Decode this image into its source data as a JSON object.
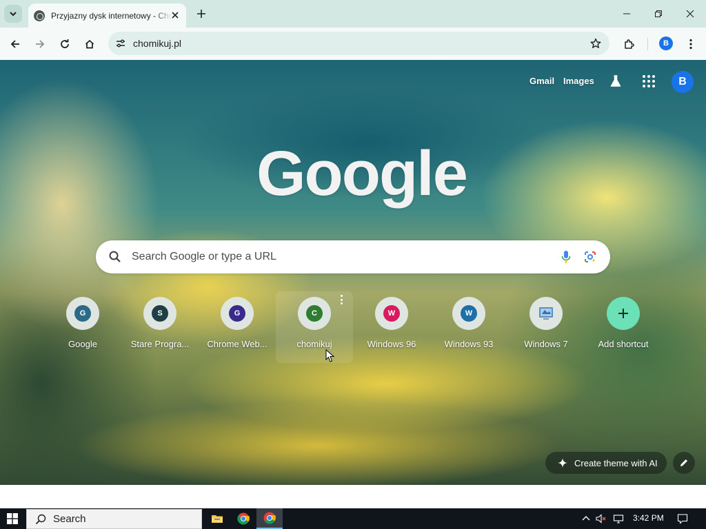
{
  "browser": {
    "tab": {
      "title": "Przyjazny dysk internetowy - Chomikuj.pl"
    },
    "omnibox": {
      "url": "chomikuj.pl"
    },
    "profile_initial": "B"
  },
  "ntp": {
    "top_links": {
      "gmail": "Gmail",
      "images": "Images"
    },
    "profile_initial": "B",
    "logo_text": "Google",
    "search": {
      "placeholder": "Search Google or type a URL"
    },
    "shortcuts": [
      {
        "label": "Google",
        "initial": "G",
        "color": "#2c6b87"
      },
      {
        "label": "Stare Progra...",
        "initial": "S",
        "color": "#1f3f46"
      },
      {
        "label": "Chrome Web...",
        "initial": "G",
        "color": "#3a2a8c"
      },
      {
        "label": "chomikuj",
        "initial": "C",
        "color": "#2e7d32"
      },
      {
        "label": "Windows 96",
        "initial": "W",
        "color": "#d81b60"
      },
      {
        "label": "Windows 93",
        "initial": "W",
        "color": "#1e6fa8"
      },
      {
        "label": "Windows 7",
        "initial": "",
        "color": "#5a8fc4"
      },
      {
        "label": "Add shortcut",
        "initial": "+",
        "color": "#6ce0b7"
      }
    ],
    "create_theme": "Create theme with AI"
  },
  "taskbar": {
    "search_label": "Search",
    "clock": "3:42 PM"
  },
  "colors": {
    "accent": "#1a73e8",
    "tab_strip": "#d3e8e3",
    "toolbar": "#f5faf8",
    "omnibox": "#e0efeb"
  },
  "icons": [
    "search-icon",
    "close-icon",
    "plus-icon",
    "minimize-icon",
    "maximize-icon",
    "back-icon",
    "forward-icon",
    "reload-icon",
    "home-icon",
    "site-info-icon",
    "star-icon",
    "extensions-icon",
    "more-vert-icon",
    "labs-icon",
    "apps-icon",
    "mic-icon",
    "lens-icon",
    "sparkle-icon",
    "pencil-icon",
    "windows-logo-icon",
    "folder-icon",
    "chrome-icon",
    "volume-muted-icon",
    "network-icon",
    "notification-icon"
  ]
}
